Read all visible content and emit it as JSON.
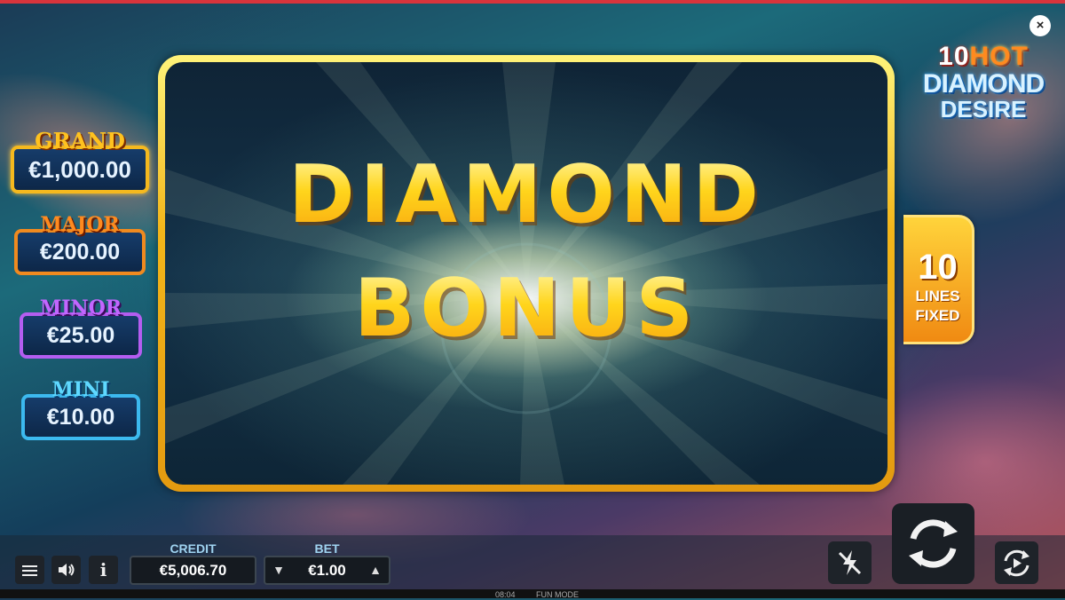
{
  "game": {
    "logo_line1_num": "10",
    "logo_line1_word": "HOT",
    "logo_line2": "DIAMOND",
    "logo_line3": "DESIRE",
    "close_label": "×"
  },
  "bonus": {
    "line1": "DIAMOND",
    "line2": "BONUS"
  },
  "lines_badge": {
    "number": "10",
    "line_a": "LINES",
    "line_b": "FIXED"
  },
  "jackpots": [
    {
      "label": "GRAND",
      "value": "€1,000.00",
      "color": "#ffc21f"
    },
    {
      "label": "MAJOR",
      "value": "€200.00",
      "color": "#ff8a1f"
    },
    {
      "label": "MINOR",
      "value": "€25.00",
      "color": "#c266ff"
    },
    {
      "label": "MINI",
      "value": "€10.00",
      "color": "#5fd9ff"
    }
  ],
  "controls": {
    "menu_icon": "hamburger-icon",
    "sound_icon": "speaker-icon",
    "info_label": "i",
    "credit_label": "CREDIT",
    "credit_value": "€5,006.70",
    "bet_label": "BET",
    "bet_value": "€1.00",
    "bet_down": "▼",
    "bet_up": "▲",
    "turbo_icon": "lightning-off-icon",
    "spin_icon": "spin-arrows-icon",
    "autoplay_icon": "autoplay-icon"
  },
  "status": {
    "time": "08:04",
    "mode": "FUN MODE"
  },
  "colors": {
    "frame_gold": "#f3b61a",
    "accent_red": "#d8343c"
  }
}
